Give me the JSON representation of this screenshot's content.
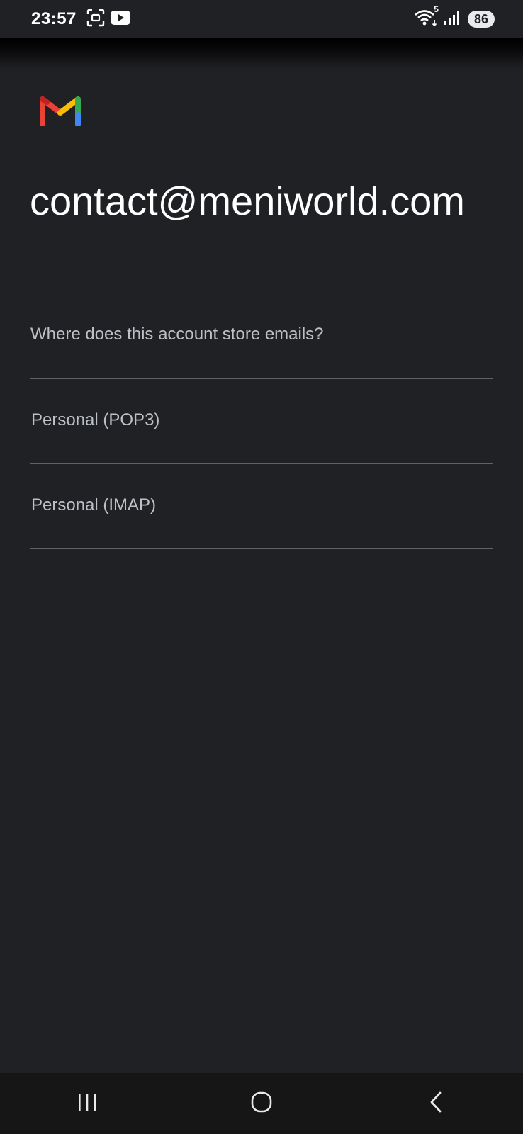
{
  "status_bar": {
    "time": "23:57",
    "battery": "86",
    "network_badge": "5",
    "left_icons": [
      "screenshot-icon",
      "youtube-icon"
    ],
    "right_icons": [
      "wifi-icon",
      "signal-icon",
      "battery-icon"
    ]
  },
  "app": {
    "logo": "gmail-logo",
    "account_email": "contact@meniworld.com",
    "question": "Where does this account store emails?",
    "options": [
      {
        "label": "Personal (POP3)"
      },
      {
        "label": "Personal (IMAP)"
      }
    ]
  },
  "nav_bar": {
    "icons": [
      "recent-apps-icon",
      "home-icon",
      "back-icon"
    ]
  },
  "colors": {
    "background": "#202124",
    "text_primary": "#ffffff",
    "text_secondary": "#bdc1c6",
    "divider": "#5f6368"
  }
}
